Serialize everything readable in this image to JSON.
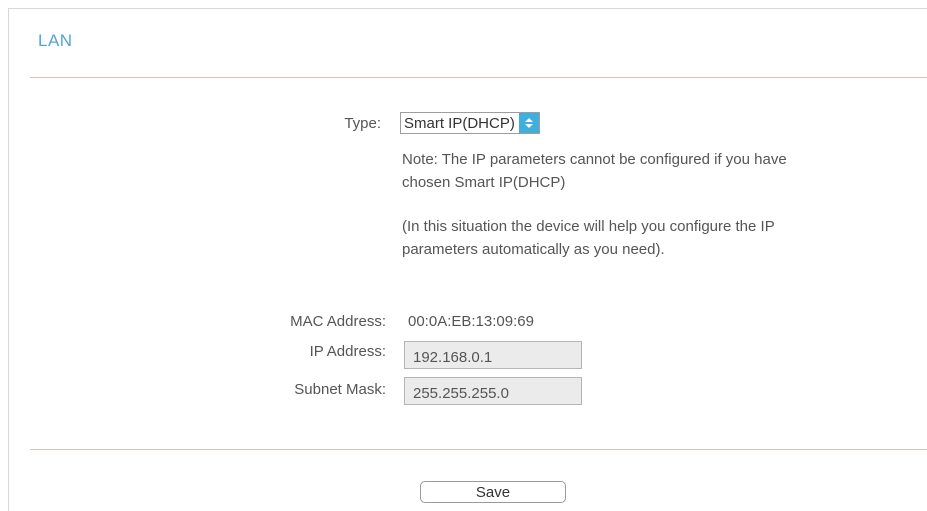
{
  "section": {
    "title": "LAN"
  },
  "form": {
    "type_label": "Type:",
    "type_value": "Smart IP(DHCP)",
    "note_line1": "Note: The IP parameters cannot be configured if you have",
    "note_line2": "chosen Smart IP(DHCP)",
    "info_line1": "(In this situation the device will help you configure the IP",
    "info_line2": "parameters automatically as you need).",
    "mac_label": "MAC Address:",
    "mac_value": "00:0A:EB:13:09:69",
    "ip_label": "IP Address:",
    "ip_value": "192.168.0.1",
    "mask_label": "Subnet Mask:",
    "mask_value": "255.255.255.0"
  },
  "actions": {
    "save_label": "Save"
  },
  "colors": {
    "accent": "#3fb0dd",
    "title": "#4fa6d6",
    "divider": "#dcc2b8"
  }
}
